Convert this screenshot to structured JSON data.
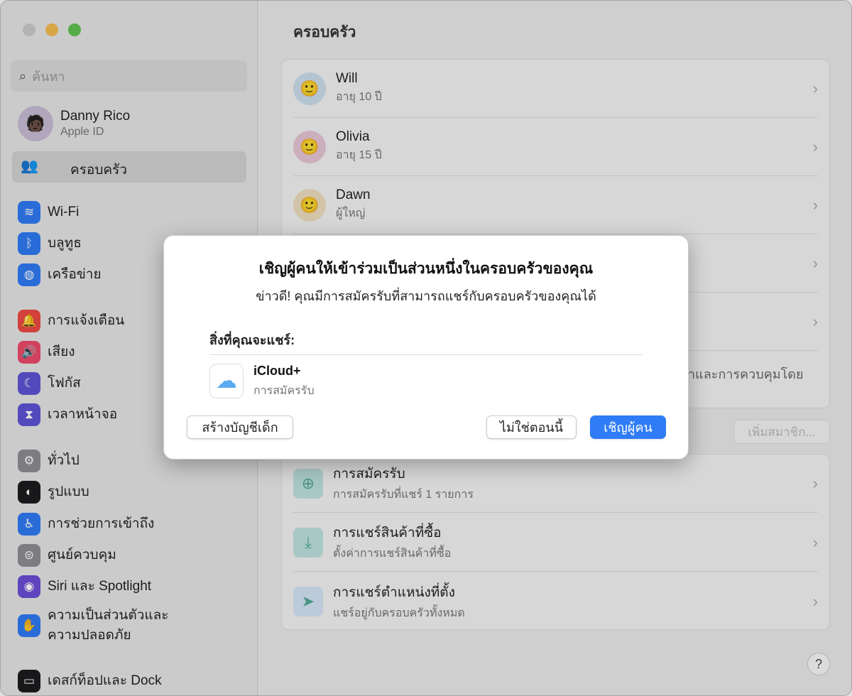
{
  "sidebar": {
    "search_placeholder": "ค้นหา",
    "user": {
      "name": "Danny Rico",
      "sub": "Apple ID"
    },
    "family": "ครอบครัว",
    "items": [
      {
        "label": "Wi-Fi",
        "icon": "wifi-icon",
        "color": "#2f7cf6",
        "glyph": "≋"
      },
      {
        "label": "บลูทูธ",
        "icon": "bluetooth-icon",
        "color": "#2f7cf6",
        "glyph": "ᛒ"
      },
      {
        "label": "เครือข่าย",
        "icon": "globe-icon",
        "color": "#2f7cf6",
        "glyph": "◍"
      },
      {
        "label": "การแจ้งเตือน",
        "icon": "bell-icon",
        "color": "#ef4a45",
        "glyph": "🔔"
      },
      {
        "label": "เสียง",
        "icon": "speaker-icon",
        "color": "#ef4a6a",
        "glyph": "🔊"
      },
      {
        "label": "โฟกัส",
        "icon": "moon-icon",
        "color": "#5e55d6",
        "glyph": "☾"
      },
      {
        "label": "เวลาหน้าจอ",
        "icon": "hourglass-icon",
        "color": "#5e55d6",
        "glyph": "⧗"
      },
      {
        "label": "ทั่วไป",
        "icon": "gear-icon",
        "color": "#8e8e93",
        "glyph": "⚙"
      },
      {
        "label": "รูปแบบ",
        "icon": "appearance-icon",
        "color": "#1c1c1e",
        "glyph": "◐"
      },
      {
        "label": "การช่วยการเข้าถึง",
        "icon": "accessibility-icon",
        "color": "#2f7cf6",
        "glyph": "♿"
      },
      {
        "label": "ศูนย์ควบคุม",
        "icon": "control-center-icon",
        "color": "#8e8e93",
        "glyph": "⊜"
      },
      {
        "label": "Siri และ Spotlight",
        "icon": "siri-icon",
        "color": "#6b4fd8",
        "glyph": "◉"
      },
      {
        "label": "ความเป็นส่วนตัวและ\nความปลอดภัย",
        "icon": "hand-icon",
        "color": "#2f7cf6",
        "glyph": "✋"
      },
      {
        "label": "เดสก์ท็อปและ Dock",
        "icon": "dock-icon",
        "color": "#1c1c1e",
        "glyph": "▭"
      }
    ]
  },
  "main": {
    "title": "ครอบครัว",
    "members": [
      {
        "name": "Will",
        "sub": "อายุ 10 ปี"
      },
      {
        "name": "Olivia",
        "sub": "อายุ 15 ปี"
      },
      {
        "name": "Dawn",
        "sub": "ผู้ใหญ่"
      }
    ],
    "partial_text": "ค่าและการควบคุมโดย",
    "add_member": "เพิ่มสมาชิก...",
    "features": [
      {
        "title": "การสมัครรับ",
        "sub": "การสมัครรับที่แชร์ 1 รายการ",
        "icon": "subscription-icon"
      },
      {
        "title": "การแชร์สินค้าที่ซื้อ",
        "sub": "ตั้งค่าการแชร์สินค้าที่ซื้อ",
        "icon": "purchase-sharing-icon"
      },
      {
        "title": "การแชร์ตำแหน่งที่ตั้ง",
        "sub": "แชร์อยู่กับครอบครัวทั้งหมด",
        "icon": "location-icon"
      }
    ],
    "help": "?"
  },
  "dialog": {
    "title": "เชิญผู้คนให้เข้าร่วมเป็นส่วนหนึ่งในครอบครัวของคุณ",
    "subtitle": "ข่าวดี! คุณมีการสมัครรับที่สามารถแชร์กับครอบครัวของคุณได้",
    "share_label": "สิ่งที่คุณจะแชร์:",
    "item": {
      "name": "iCloud+",
      "sub": "การสมัครรับ"
    },
    "create_child": "สร้างบัญชีเด็ก",
    "not_now": "ไม่ใช่ตอนนี้",
    "invite": "เชิญผู้คน",
    "accent": "#2f7cf6"
  }
}
